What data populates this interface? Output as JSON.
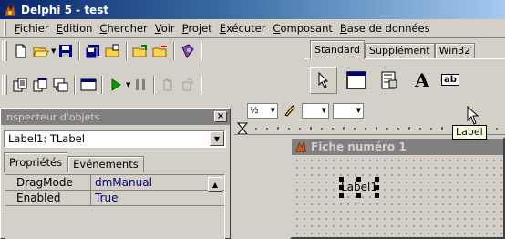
{
  "window": {
    "title": "Delphi 5 - test"
  },
  "menu": [
    {
      "label": "Fichier"
    },
    {
      "label": "Edition"
    },
    {
      "label": "Chercher"
    },
    {
      "label": "Voir"
    },
    {
      "label": "Projet"
    },
    {
      "label": "Exécuter"
    },
    {
      "label": "Composant"
    },
    {
      "label": "Base de données"
    }
  ],
  "palette": {
    "tabs": [
      "Standard",
      "Supplément",
      "Win32"
    ],
    "active_tab": "Standard",
    "label_button_text": "A",
    "edit_button_text": "ab"
  },
  "tooltip": "Label",
  "editor_strip": {
    "zoom_text": "½"
  },
  "form": {
    "title": "Fiche numéro 1",
    "label_caption": "Label1"
  },
  "inspector": {
    "title": "Inspecteur d'objets",
    "selected_object": "Label1: TLabel",
    "tabs": [
      "Propriétés",
      "Evénements"
    ],
    "properties": [
      {
        "name": "DragMode",
        "value": "dmManual"
      },
      {
        "name": "Enabled",
        "value": "True"
      }
    ]
  },
  "colors": {
    "title_active": "#0a246a",
    "title_inactive": "#808080",
    "face": "#d4d0c8",
    "value_text": "#000080",
    "tooltip_bg": "#ffffe1"
  }
}
